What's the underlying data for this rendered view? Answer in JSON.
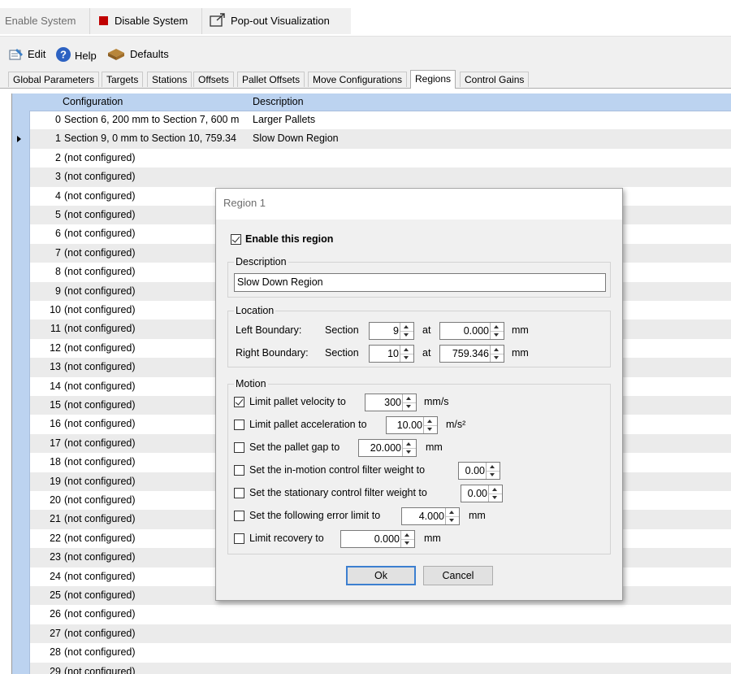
{
  "toolbar": {
    "enable_label": "Enable System",
    "disable_label": "Disable System",
    "popout_label": "Pop-out Visualization"
  },
  "editbar": {
    "edit_label": "Edit",
    "help_label": "Help",
    "defaults_label": "Defaults"
  },
  "tabs": [
    {
      "label": "Global Parameters"
    },
    {
      "label": "Targets"
    },
    {
      "label": "Stations"
    },
    {
      "label": "Offsets"
    },
    {
      "label": "Pallet Offsets"
    },
    {
      "label": "Move Configurations"
    },
    {
      "label": "Regions"
    },
    {
      "label": "Control Gains"
    }
  ],
  "active_tab": "Regions",
  "grid": {
    "columns": [
      "Configuration",
      "Description"
    ],
    "rows": [
      {
        "num": "0",
        "config": "Section 6, 200 mm to Section 7, 600 m",
        "desc": "Larger Pallets"
      },
      {
        "num": "1",
        "config": "Section 9, 0 mm to Section 10, 759.34",
        "desc": "Slow Down Region"
      },
      {
        "num": "2",
        "config": "(not configured)",
        "desc": ""
      },
      {
        "num": "3",
        "config": "(not configured)",
        "desc": ""
      },
      {
        "num": "4",
        "config": "(not configured)",
        "desc": ""
      },
      {
        "num": "5",
        "config": "(not configured)",
        "desc": ""
      },
      {
        "num": "6",
        "config": "(not configured)",
        "desc": ""
      },
      {
        "num": "7",
        "config": "(not configured)",
        "desc": ""
      },
      {
        "num": "8",
        "config": "(not configured)",
        "desc": ""
      },
      {
        "num": "9",
        "config": "(not configured)",
        "desc": ""
      },
      {
        "num": "10",
        "config": "(not configured)",
        "desc": ""
      },
      {
        "num": "11",
        "config": "(not configured)",
        "desc": ""
      },
      {
        "num": "12",
        "config": "(not configured)",
        "desc": ""
      },
      {
        "num": "13",
        "config": "(not configured)",
        "desc": ""
      },
      {
        "num": "14",
        "config": "(not configured)",
        "desc": ""
      },
      {
        "num": "15",
        "config": "(not configured)",
        "desc": ""
      },
      {
        "num": "16",
        "config": "(not configured)",
        "desc": ""
      },
      {
        "num": "17",
        "config": "(not configured)",
        "desc": ""
      },
      {
        "num": "18",
        "config": "(not configured)",
        "desc": ""
      },
      {
        "num": "19",
        "config": "(not configured)",
        "desc": ""
      },
      {
        "num": "20",
        "config": "(not configured)",
        "desc": ""
      },
      {
        "num": "21",
        "config": "(not configured)",
        "desc": ""
      },
      {
        "num": "22",
        "config": "(not configured)",
        "desc": ""
      },
      {
        "num": "23",
        "config": "(not configured)",
        "desc": ""
      },
      {
        "num": "24",
        "config": "(not configured)",
        "desc": ""
      },
      {
        "num": "25",
        "config": "(not configured)",
        "desc": ""
      },
      {
        "num": "26",
        "config": "(not configured)",
        "desc": ""
      },
      {
        "num": "27",
        "config": "(not configured)",
        "desc": ""
      },
      {
        "num": "28",
        "config": "(not configured)",
        "desc": ""
      },
      {
        "num": "29",
        "config": "(not configured)",
        "desc": ""
      }
    ],
    "selected_row": 1
  },
  "dialog": {
    "title": "Region 1",
    "enable_label": "Enable this region",
    "enable_checked": true,
    "description_group": "Description",
    "description_value": "Slow Down Region",
    "location_group": "Location",
    "left_label": "Left Boundary:",
    "right_label": "Right Boundary:",
    "section_label": "Section",
    "at_label": "at",
    "mm_label": "mm",
    "left_section": "9",
    "left_at": "0.000",
    "right_section": "10",
    "right_at": "759.346",
    "motion_group": "Motion",
    "motion": [
      {
        "label": "Limit pallet velocity to",
        "checked": true,
        "value": "300",
        "unit": "mm/s"
      },
      {
        "label": "Limit pallet acceleration to",
        "checked": false,
        "value": "10.00",
        "unit": "m/s²"
      },
      {
        "label": "Set the pallet gap to",
        "checked": false,
        "value": "20.000",
        "unit": "mm"
      },
      {
        "label": "Set the in-motion control filter weight to",
        "checked": false,
        "value": "0.00",
        "unit": ""
      },
      {
        "label": "Set the stationary control filter weight to",
        "checked": false,
        "value": "0.00",
        "unit": ""
      },
      {
        "label": "Set the following error limit to",
        "checked": false,
        "value": "4.000",
        "unit": "mm"
      },
      {
        "label": "Limit recovery to",
        "checked": false,
        "value": "0.000",
        "unit": "mm"
      }
    ],
    "ok_label": "Ok",
    "cancel_label": "Cancel"
  }
}
